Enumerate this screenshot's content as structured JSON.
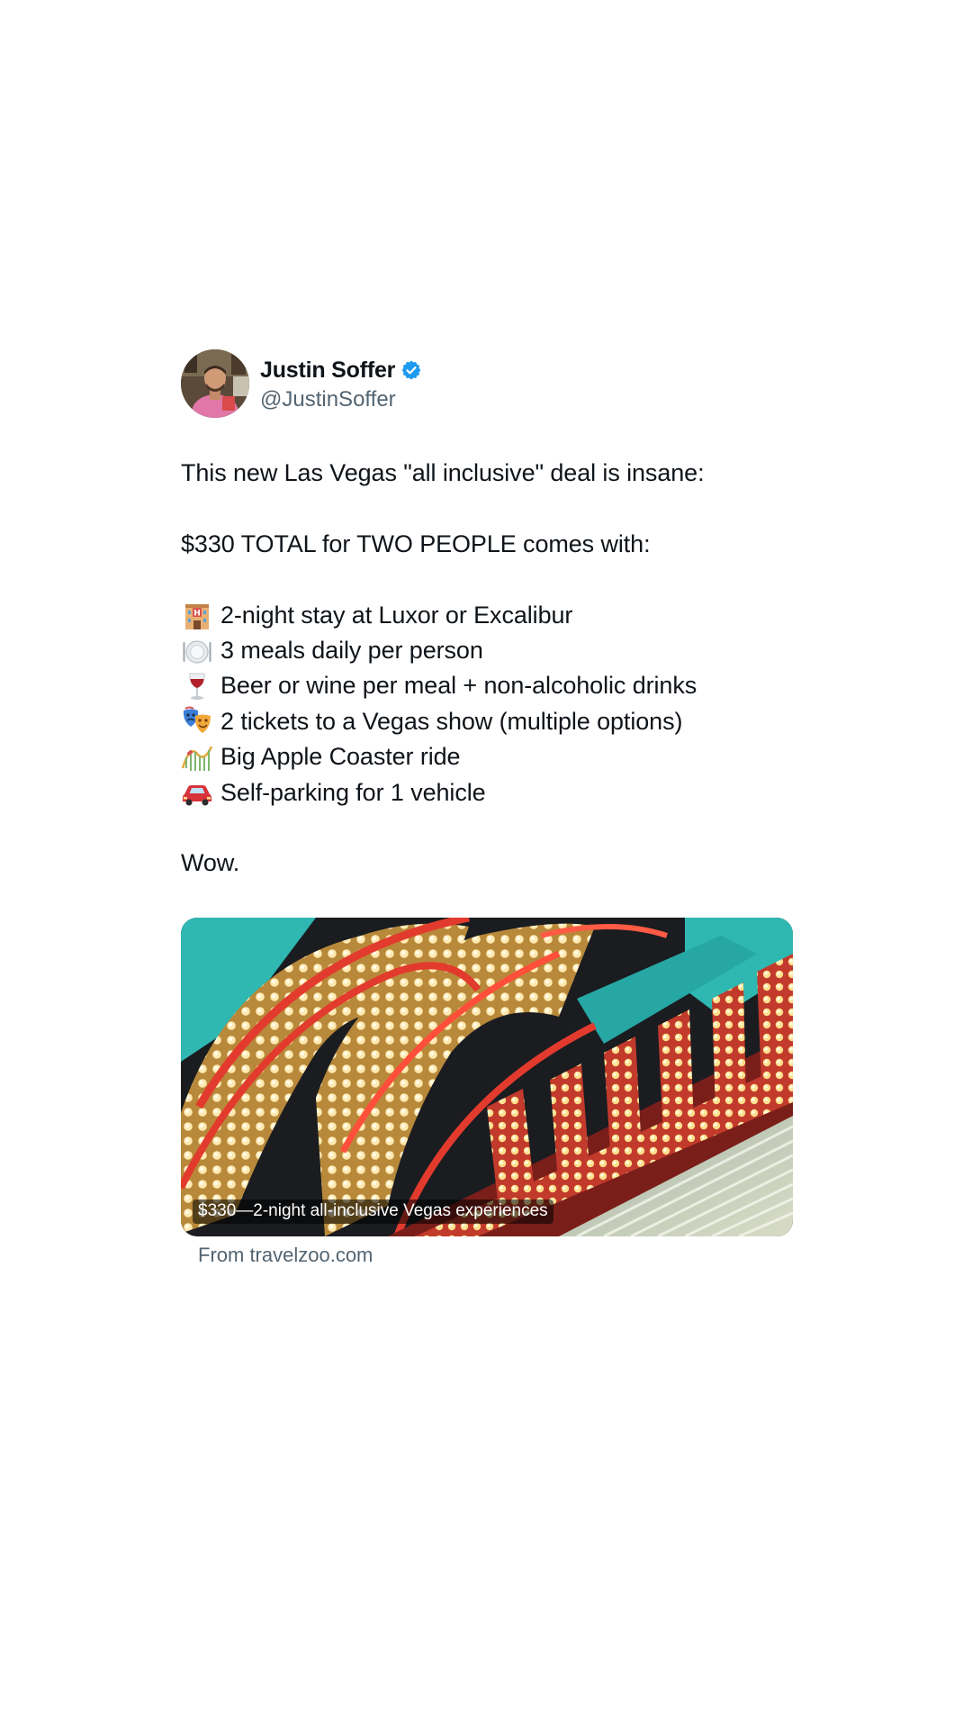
{
  "author": {
    "name": "Justin Soffer",
    "handle": "@JustinSoffer",
    "verified": true,
    "verified_color": "#1d9bf0"
  },
  "tweet": {
    "intro": "This new Las Vegas \"all inclusive\" deal is insane:",
    "headline": "$330 TOTAL for TWO PEOPLE comes with:",
    "items": [
      {
        "icon": "hotel-icon",
        "text": "2-night stay at Luxor or Excalibur"
      },
      {
        "icon": "plate-icon",
        "text": "3 meals daily per person"
      },
      {
        "icon": "wine-glass-icon",
        "text": "Beer or wine per meal + non-alcoholic drinks"
      },
      {
        "icon": "theater-masks-icon",
        "text": "2 tickets to a Vegas show (multiple options)"
      },
      {
        "icon": "roller-coaster-icon",
        "text": "Big Apple Coaster ride"
      },
      {
        "icon": "car-icon",
        "text": "Self-parking for 1 vehicle"
      }
    ],
    "closing": "Wow."
  },
  "link_card": {
    "title": "$330—2-night all-inclusive Vegas experiences",
    "source": "From travelzoo.com"
  }
}
